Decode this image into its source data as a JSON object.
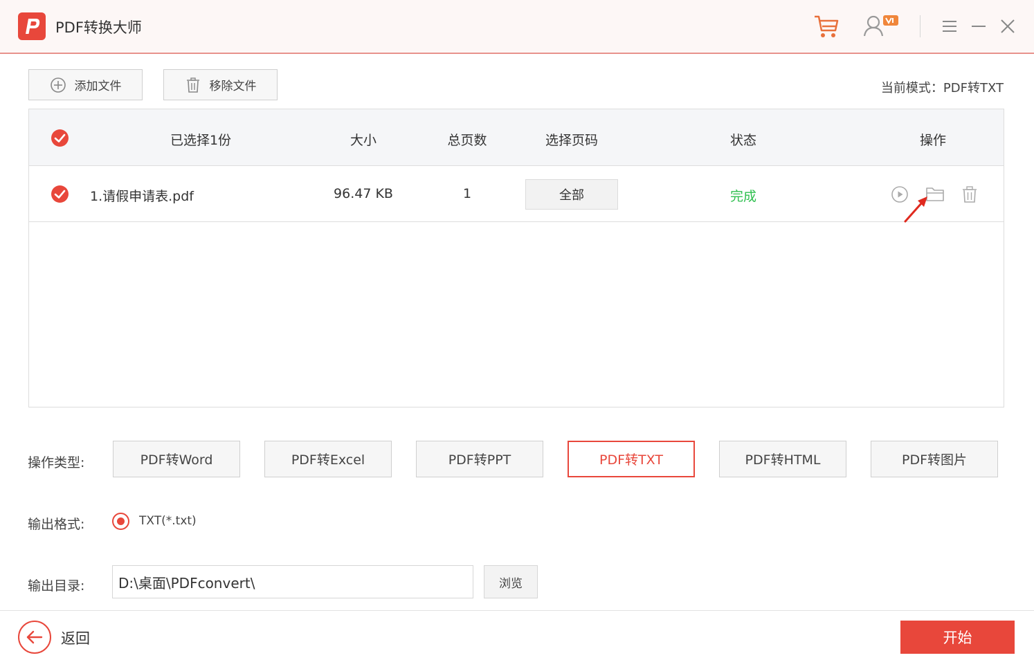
{
  "app": {
    "title": "PDF转换大师"
  },
  "colors": {
    "accent": "#e8473b",
    "done": "#2fbf4f"
  },
  "toolbar": {
    "add_label": "添加文件",
    "remove_label": "移除文件",
    "mode_text": "当前模式：PDF转TXT"
  },
  "table": {
    "headers": {
      "selected": "已选择1份",
      "size": "大小",
      "pages": "总页数",
      "page_select": "选择页码",
      "status": "状态",
      "actions": "操作"
    },
    "rows": [
      {
        "name": "1.请假申请表.pdf",
        "size": "96.47 KB",
        "pages": "1",
        "page_select": "全部",
        "status": "完成"
      }
    ]
  },
  "settings": {
    "type_label": "操作类型:",
    "types": [
      "PDF转Word",
      "PDF转Excel",
      "PDF转PPT",
      "PDF转TXT",
      "PDF转HTML",
      "PDF转图片"
    ],
    "active_type": "PDF转TXT",
    "format_label": "输出格式:",
    "format_option": "TXT(*.txt)",
    "dir_label": "输出目录:",
    "dir_value": "D:\\桌面\\PDFconvert\\",
    "browse_label": "浏览"
  },
  "footer": {
    "back_label": "返回",
    "start_label": "开始"
  }
}
